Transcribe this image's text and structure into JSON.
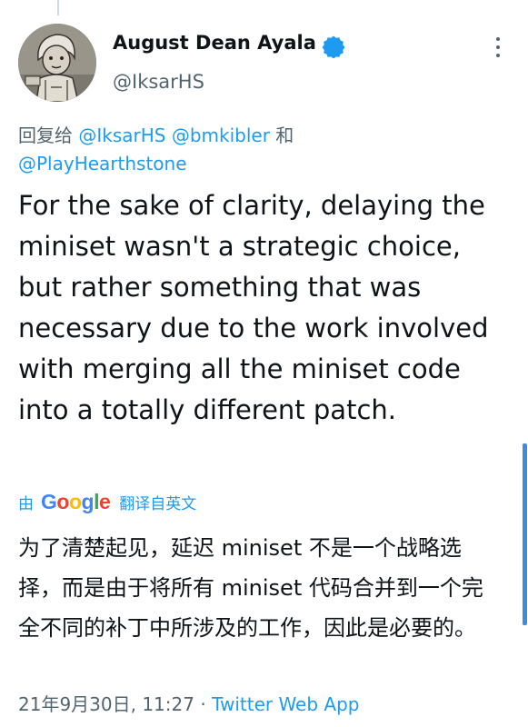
{
  "author": {
    "name": "August Dean Ayala",
    "handle": "@IksarHS"
  },
  "reply": {
    "prefix": "回复给 ",
    "mentions": [
      "@IksarHS",
      "@bmkibler",
      "@PlayHearthstone"
    ],
    "and_word": " 和"
  },
  "tweet": {
    "text": "For the sake of clarity, delaying the miniset wasn't a strategic choice, but rather something that was necessary due to the work involved with merging all the miniset code into a totally different patch."
  },
  "translation": {
    "by": "由",
    "provider": "Google",
    "label": "翻译自英文",
    "text": "为了清楚起见，延迟 miniset 不是一个战略选择，而是由于将所有 miniset 代码合并到一个完全不同的补丁中所涉及的工作，因此是必要的。"
  },
  "meta": {
    "timestamp": "21年9月30日, 11:27",
    "separator": " · ",
    "source": "Twitter Web App"
  },
  "colors": {
    "link": "#1d9bf0",
    "verified": "#1d9bf0",
    "secondary_text": "#536471"
  }
}
